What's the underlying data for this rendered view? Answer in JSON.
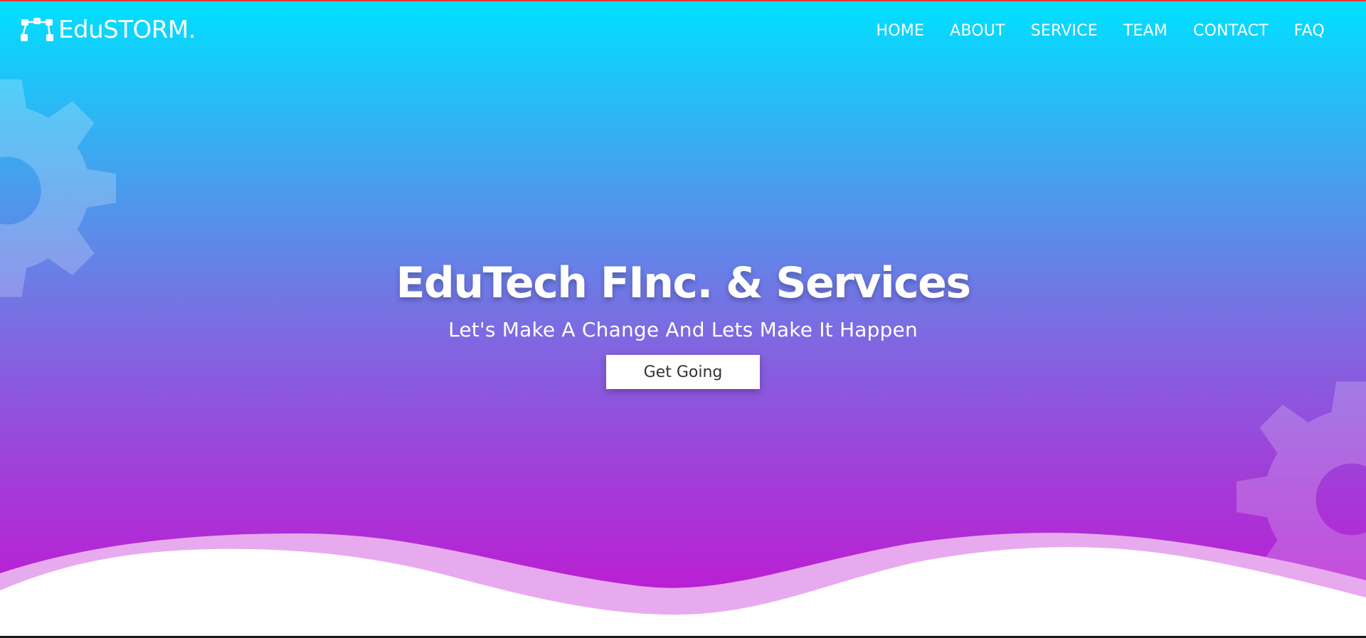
{
  "brand": {
    "name": "EduSTORM.",
    "icon": "sitemap-icon"
  },
  "nav": {
    "items": [
      {
        "label": "HOME"
      },
      {
        "label": "ABOUT"
      },
      {
        "label": "SERVICE"
      },
      {
        "label": "TEAM"
      },
      {
        "label": "CONTACT"
      },
      {
        "label": "FAQ"
      }
    ]
  },
  "hero": {
    "title": "EduTech FInc. & Services",
    "subtitle": "Let's Make A Change And Lets Make It Happen",
    "cta_label": "Get Going",
    "decor_icons": [
      "gear-icon",
      "gear-icon"
    ]
  },
  "colors": {
    "gradient_top": "#00e0ff",
    "gradient_bottom": "#c313d2",
    "top_line": "#e53935",
    "text": "#ffffff",
    "button_bg": "#ffffff",
    "button_text": "#333333"
  }
}
